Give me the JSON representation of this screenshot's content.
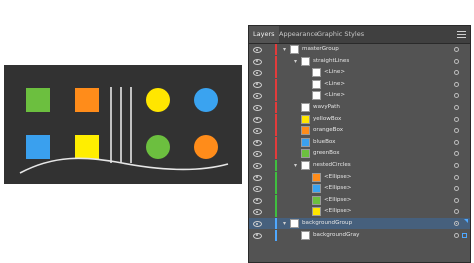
{
  "artboard": {
    "background": "#323232",
    "squares": [
      "#6cbf3f",
      "#ff8c1a",
      "#3aa0ee",
      "#ffee00"
    ],
    "circles": [
      "#ffe600",
      "#3aa3f0",
      "#6cbf3f",
      "#ff8c1a"
    ],
    "line_color": "#e6e6e6"
  },
  "panel": {
    "tabs": [
      {
        "label": "Layers",
        "active": true
      },
      {
        "label": "Appearance",
        "active": false
      },
      {
        "label": "Graphic Styles",
        "active": false
      }
    ],
    "menu_icon": "hamburger-menu-icon",
    "colors": {
      "red_layer": "#e23b3b",
      "green_layer": "#3fbf3f",
      "selection": "#46607d",
      "selected_art": "#4fa8ff"
    },
    "rows": [
      {
        "label": "masterGroup",
        "thumb": "#ffffff"
      },
      {
        "label": "straightLines",
        "thumb": "#ffffff"
      },
      {
        "label": "<Line>",
        "thumb": "#ffffff"
      },
      {
        "label": "<Line>",
        "thumb": "#ffffff"
      },
      {
        "label": "<Line>",
        "thumb": "#ffffff"
      },
      {
        "label": "wavyPath",
        "thumb": "#ffffff"
      },
      {
        "label": "yellowBox",
        "thumb": "#ffe600"
      },
      {
        "label": "orangeBox",
        "thumb": "#ff8c1a"
      },
      {
        "label": "blueBox",
        "thumb": "#3aa0ee"
      },
      {
        "label": "greenBox",
        "thumb": "#6cbf3f"
      },
      {
        "label": "nestedCircles",
        "thumb": "#ffffff"
      },
      {
        "label": "<Ellipse>",
        "thumb": "#ff8c1a"
      },
      {
        "label": "<Ellipse>",
        "thumb": "#3aa3f0"
      },
      {
        "label": "<Ellipse>",
        "thumb": "#6cbf3f"
      },
      {
        "label": "<Ellipse>",
        "thumb": "#ffe600"
      },
      {
        "label": "backgroundGroup",
        "thumb": "#ffffff"
      },
      {
        "label": "backgroundGray",
        "thumb": "#ffffff"
      }
    ]
  }
}
